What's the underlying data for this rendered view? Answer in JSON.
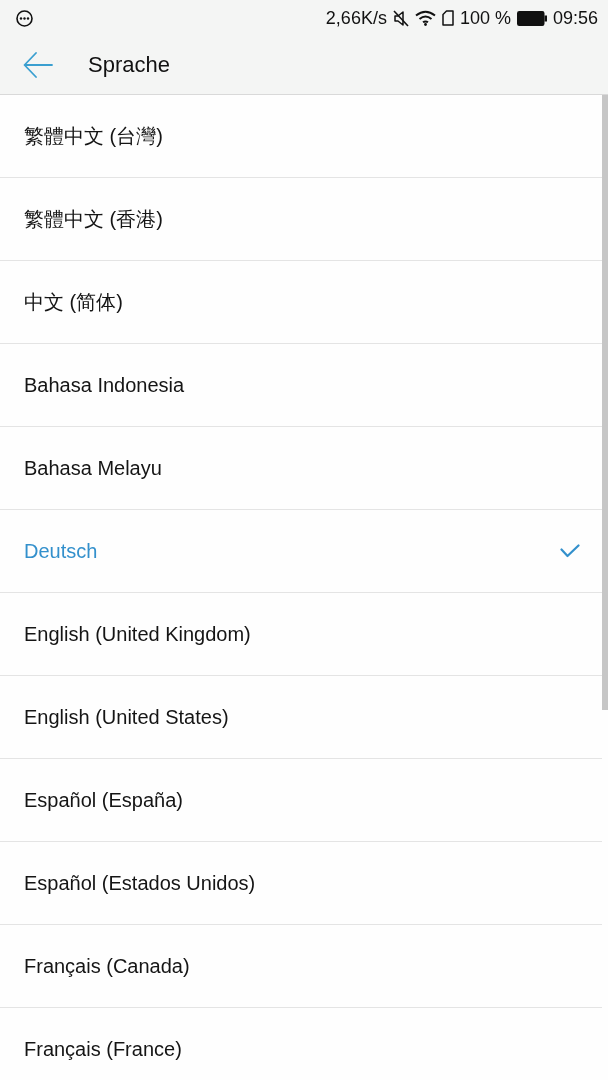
{
  "status_bar": {
    "net_speed": "2,66K/s",
    "battery_percent": "100 %",
    "time": "09:56"
  },
  "header": {
    "title": "Sprache"
  },
  "languages": [
    {
      "label": "繁體中文 (台灣)",
      "selected": false
    },
    {
      "label": "繁體中文 (香港)",
      "selected": false
    },
    {
      "label": "中文 (简体)",
      "selected": false
    },
    {
      "label": "Bahasa Indonesia",
      "selected": false
    },
    {
      "label": "Bahasa Melayu",
      "selected": false
    },
    {
      "label": "Deutsch",
      "selected": true
    },
    {
      "label": "English (United Kingdom)",
      "selected": false
    },
    {
      "label": "English (United States)",
      "selected": false
    },
    {
      "label": "Español (España)",
      "selected": false
    },
    {
      "label": "Español (Estados Unidos)",
      "selected": false
    },
    {
      "label": "Français (Canada)",
      "selected": false
    },
    {
      "label": "Français (France)",
      "selected": false
    }
  ]
}
